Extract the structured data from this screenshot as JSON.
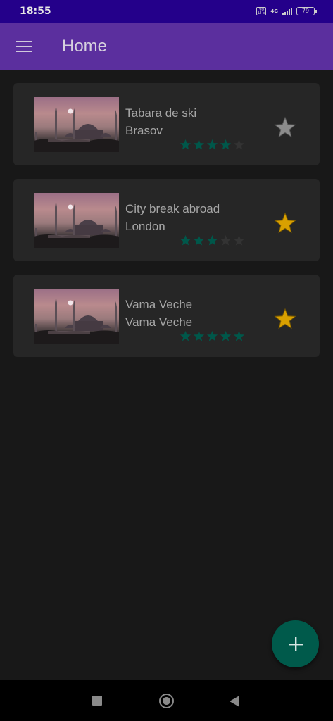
{
  "status_bar": {
    "time": "18:55",
    "volte_label": "Vo LTE",
    "network_label": "4G",
    "battery_level": "79"
  },
  "app_bar": {
    "title": "Home",
    "menu_icon": "hamburger-menu-icon"
  },
  "trips": [
    {
      "title": "Tabara de ski",
      "location": "Brasov",
      "rating": 4,
      "max_rating": 5,
      "favorite": false
    },
    {
      "title": "City break abroad",
      "location": "London",
      "rating": 3,
      "max_rating": 5,
      "favorite": true
    },
    {
      "title": "Vama Veche",
      "location": "Vama Veche",
      "rating": 5,
      "max_rating": 5,
      "favorite": true
    }
  ],
  "fab": {
    "icon": "plus-icon"
  },
  "navigation": {
    "icons": [
      "square-recents-icon",
      "circle-home-icon",
      "triangle-back-icon"
    ]
  },
  "colors": {
    "status_bar": "#24008a",
    "app_bar": "#5b2f9e",
    "background": "#181818",
    "card": "#262626",
    "rating_star_filled": "#00574a",
    "rating_star_empty": "#333333",
    "favorite_star": "#d9a000",
    "not_favorite_star": "#8c8c8c",
    "fab": "#005a4b"
  }
}
